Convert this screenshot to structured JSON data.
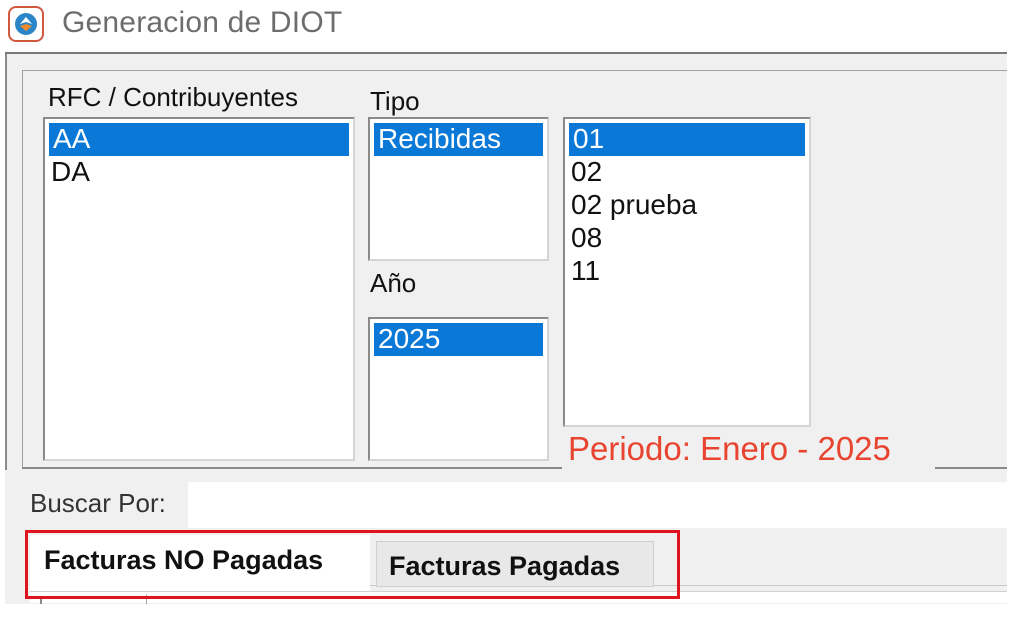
{
  "window": {
    "title": "Generacion de DIOT",
    "icon": "app-logo-icon"
  },
  "filters": {
    "rfc_label": "RFC / Contribuyentes",
    "rfc_items": [
      "AA",
      "DA"
    ],
    "rfc_selected_index": 0,
    "tipo_label": "Tipo",
    "tipo_items": [
      "Recibidas"
    ],
    "tipo_selected_index": 0,
    "anio_label": "Año",
    "anio_items": [
      "2025"
    ],
    "anio_selected_index": 0,
    "mes_items": [
      "01",
      "02",
      "02 prueba",
      "08",
      "11"
    ],
    "mes_selected_index": 0,
    "periodo_text": "Periodo: Enero - 2025"
  },
  "search": {
    "label": "Buscar Por:",
    "value": "",
    "placeholder": ""
  },
  "tabs": [
    {
      "label": "Facturas NO Pagadas",
      "active": true
    },
    {
      "label": "Facturas Pagadas",
      "active": false
    }
  ],
  "colors": {
    "selection": "#0a78d7",
    "periodo": "#e8442f",
    "highlight": "#e0141e"
  }
}
